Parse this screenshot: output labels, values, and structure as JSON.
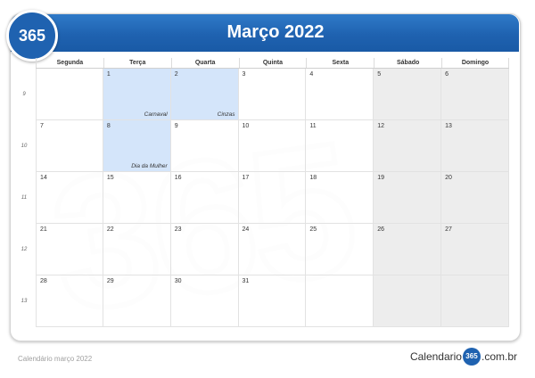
{
  "title": "Março 2022",
  "logo": "365",
  "watermark": "365",
  "weekdays": [
    "Segunda",
    "Terça",
    "Quarta",
    "Quinta",
    "Sexta",
    "Sábado",
    "Domingo"
  ],
  "week_numbers": [
    "9",
    "10",
    "11",
    "12",
    "13"
  ],
  "weeks": [
    [
      {
        "day": "",
        "event": "",
        "kind": "empty"
      },
      {
        "day": "1",
        "event": "Carnaval",
        "kind": "holiday"
      },
      {
        "day": "2",
        "event": "Cinzas",
        "kind": "holiday"
      },
      {
        "day": "3",
        "event": "",
        "kind": "normal"
      },
      {
        "day": "4",
        "event": "",
        "kind": "normal"
      },
      {
        "day": "5",
        "event": "",
        "kind": "weekend"
      },
      {
        "day": "6",
        "event": "",
        "kind": "weekend"
      }
    ],
    [
      {
        "day": "7",
        "event": "",
        "kind": "normal"
      },
      {
        "day": "8",
        "event": "Dia da Mulher",
        "kind": "holiday"
      },
      {
        "day": "9",
        "event": "",
        "kind": "normal"
      },
      {
        "day": "10",
        "event": "",
        "kind": "normal"
      },
      {
        "day": "11",
        "event": "",
        "kind": "normal"
      },
      {
        "day": "12",
        "event": "",
        "kind": "weekend"
      },
      {
        "day": "13",
        "event": "",
        "kind": "weekend"
      }
    ],
    [
      {
        "day": "14",
        "event": "",
        "kind": "normal"
      },
      {
        "day": "15",
        "event": "",
        "kind": "normal"
      },
      {
        "day": "16",
        "event": "",
        "kind": "normal"
      },
      {
        "day": "17",
        "event": "",
        "kind": "normal"
      },
      {
        "day": "18",
        "event": "",
        "kind": "normal"
      },
      {
        "day": "19",
        "event": "",
        "kind": "weekend"
      },
      {
        "day": "20",
        "event": "",
        "kind": "weekend"
      }
    ],
    [
      {
        "day": "21",
        "event": "",
        "kind": "normal"
      },
      {
        "day": "22",
        "event": "",
        "kind": "normal"
      },
      {
        "day": "23",
        "event": "",
        "kind": "normal"
      },
      {
        "day": "24",
        "event": "",
        "kind": "normal"
      },
      {
        "day": "25",
        "event": "",
        "kind": "normal"
      },
      {
        "day": "26",
        "event": "",
        "kind": "weekend"
      },
      {
        "day": "27",
        "event": "",
        "kind": "weekend"
      }
    ],
    [
      {
        "day": "28",
        "event": "",
        "kind": "normal"
      },
      {
        "day": "29",
        "event": "",
        "kind": "normal"
      },
      {
        "day": "30",
        "event": "",
        "kind": "normal"
      },
      {
        "day": "31",
        "event": "",
        "kind": "normal"
      },
      {
        "day": "",
        "event": "",
        "kind": "empty"
      },
      {
        "day": "",
        "event": "",
        "kind": "weekend"
      },
      {
        "day": "",
        "event": "",
        "kind": "weekend"
      }
    ]
  ],
  "footer": {
    "caption": "Calendário março 2022",
    "brand_prefix": "Calendario",
    "brand_badge": "365",
    "brand_suffix": ".com.br"
  },
  "colors": {
    "header": "#1f62b0",
    "holiday": "#d2e4fa",
    "weekend": "#ececec"
  }
}
